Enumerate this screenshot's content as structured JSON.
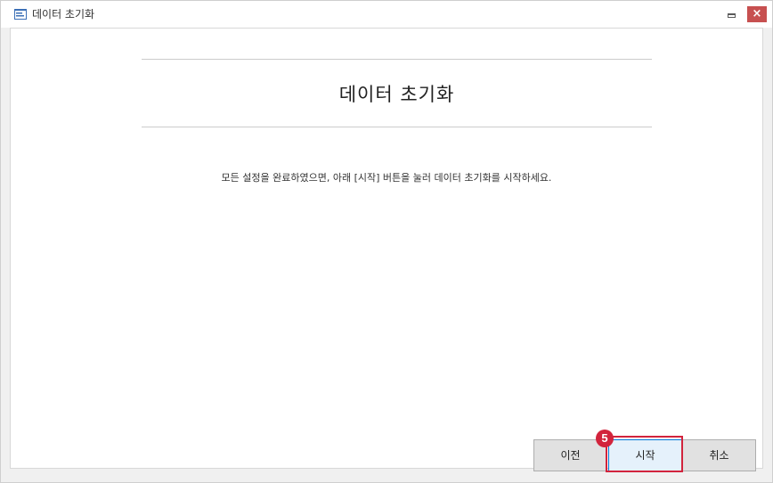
{
  "window": {
    "title": "데이터 초기화",
    "icon": "app-icon",
    "close_label": "×"
  },
  "content": {
    "heading": "데이터 초기화",
    "instruction": "모든 설정을 완료하였으면, 아래 [시작] 버튼을 눌러 데이터 초기화를 시작하세요."
  },
  "buttons": {
    "prev_label": "이전",
    "start_label": "시작",
    "cancel_label": "취소"
  },
  "annotation": {
    "step_number": "5",
    "color": "#d2243c"
  }
}
